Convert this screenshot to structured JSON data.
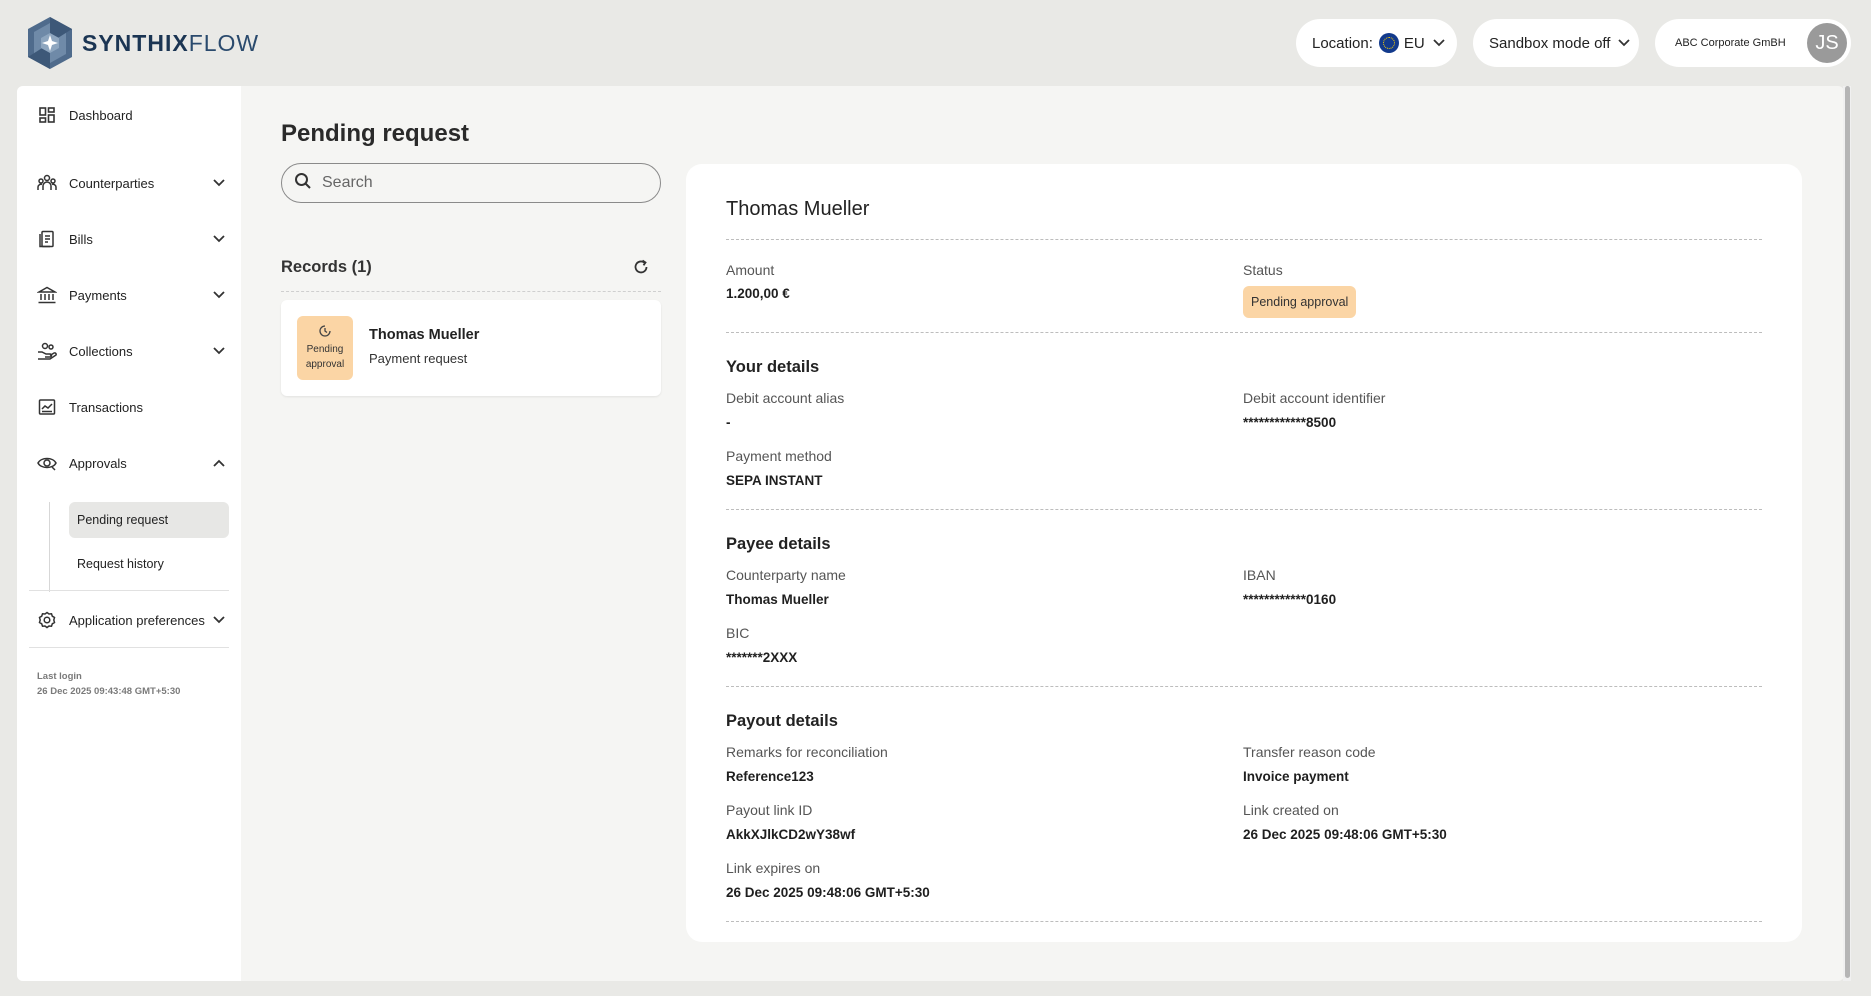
{
  "header": {
    "brand_bold": "SYNTHIX",
    "brand_light": "FLOW",
    "location_label": "Location:",
    "location_value": "EU",
    "sandbox_label": "Sandbox mode off",
    "company": "ABC Corporate GmBH",
    "avatar_initials": "JS"
  },
  "sidebar": {
    "items": [
      {
        "label": "Dashboard",
        "icon": "dashboard-icon"
      },
      {
        "label": "Counterparties",
        "icon": "people-icon"
      },
      {
        "label": "Bills",
        "icon": "bill-icon"
      },
      {
        "label": "Payments",
        "icon": "bank-icon"
      },
      {
        "label": "Collections",
        "icon": "hand-coins-icon"
      },
      {
        "label": "Transactions",
        "icon": "transactions-icon"
      },
      {
        "label": "Approvals",
        "icon": "eye-icon"
      },
      {
        "label": "Application preferences",
        "icon": "gear-icon"
      }
    ],
    "approvals_sub": [
      {
        "label": "Pending request",
        "active": true
      },
      {
        "label": "Request history",
        "active": false
      }
    ],
    "last_login_label": "Last login",
    "last_login_value": "26 Dec 2025 09:43:48 GMT+5:30"
  },
  "main": {
    "title": "Pending request",
    "search_placeholder": "Search",
    "records_title": "Records (1)",
    "records": [
      {
        "status_line1": "Pending",
        "status_line2": "approval",
        "name": "Thomas Mueller",
        "type": "Payment request"
      }
    ]
  },
  "detail": {
    "name": "Thomas Mueller",
    "amount_label": "Amount",
    "amount_value": "1.200,00 €",
    "status_label": "Status",
    "status_value": "Pending approval",
    "your_details": {
      "title": "Your details",
      "debit_alias_label": "Debit account alias",
      "debit_alias_value": "-",
      "debit_id_label": "Debit account identifier",
      "debit_id_value": "************8500",
      "payment_method_label": "Payment method",
      "payment_method_value": "SEPA INSTANT"
    },
    "payee_details": {
      "title": "Payee details",
      "counterparty_label": "Counterparty name",
      "counterparty_value": "Thomas Mueller",
      "iban_label": "IBAN",
      "iban_value": "************0160",
      "bic_label": "BIC",
      "bic_value": "*******2XXX"
    },
    "payout_details": {
      "title": "Payout details",
      "remarks_label": "Remarks for reconciliation",
      "remarks_value": "Reference123",
      "reason_label": "Transfer reason code",
      "reason_value": "Invoice payment",
      "link_id_label": "Payout link ID",
      "link_id_value": "AkkXJlkCD2wY38wf",
      "created_label": "Link created on",
      "created_value": "26 Dec 2025 09:48:06 GMT+5:30",
      "expires_label": "Link expires on",
      "expires_value": "26 Dec 2025 09:48:06 GMT+5:30"
    }
  }
}
